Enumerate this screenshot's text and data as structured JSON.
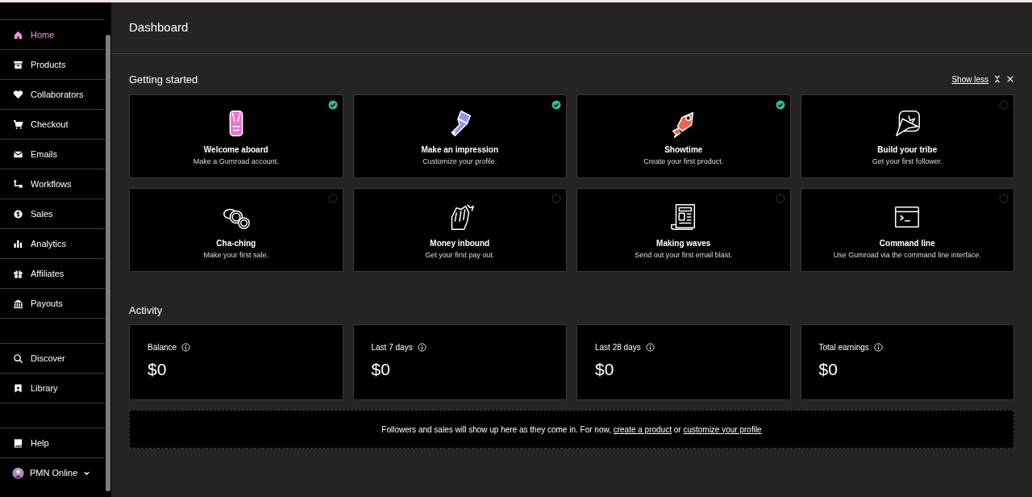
{
  "sidebar": {
    "groups": [
      [
        {
          "label": "Home",
          "selected": true
        },
        {
          "label": "Products",
          "selected": false
        },
        {
          "label": "Collaborators",
          "selected": false
        },
        {
          "label": "Checkout",
          "selected": false
        },
        {
          "label": "Emails",
          "selected": false
        },
        {
          "label": "Workflows",
          "selected": false
        },
        {
          "label": "Sales",
          "selected": false
        },
        {
          "label": "Analytics",
          "selected": false
        },
        {
          "label": "Affiliates",
          "selected": false
        },
        {
          "label": "Payouts",
          "selected": false
        }
      ],
      [
        {
          "label": "Discover",
          "selected": false
        },
        {
          "label": "Library",
          "selected": false
        }
      ],
      [
        {
          "label": "Help",
          "selected": false
        }
      ]
    ],
    "account": {
      "label": "PMN Online"
    }
  },
  "header": {
    "title": "Dashboard"
  },
  "getting_started": {
    "title": "Getting started",
    "show_less": "Show less",
    "tasks": [
      {
        "title": "Welcome aboard",
        "subtitle": "Make a Gumroad account.",
        "checked": true
      },
      {
        "title": "Make an impression",
        "subtitle": "Customize your profile.",
        "checked": true
      },
      {
        "title": "Showtime",
        "subtitle": "Create your first product.",
        "checked": true
      },
      {
        "title": "Build your tribe",
        "subtitle": "Get your first follower.",
        "checked": false
      },
      {
        "title": "Cha-ching",
        "subtitle": "Make your first sale.",
        "checked": false
      },
      {
        "title": "Money inbound",
        "subtitle": "Get your first pay out.",
        "checked": false
      },
      {
        "title": "Making waves",
        "subtitle": "Send out your first email blast.",
        "checked": false
      },
      {
        "title": "Command line",
        "subtitle": "Use Gumroad via the command line interface.",
        "checked": false
      }
    ]
  },
  "activity": {
    "title": "Activity",
    "stats": [
      {
        "label": "Balance",
        "value": "$0"
      },
      {
        "label": "Last 7 days",
        "value": "$0"
      },
      {
        "label": "Last 28 days",
        "value": "$0"
      },
      {
        "label": "Total earnings",
        "value": "$0"
      }
    ],
    "message": {
      "text": "Followers and sales will show up here as they come in. For now,",
      "link_1": "create a product",
      "joiner": "or",
      "link_2": "customize your profile"
    }
  }
}
